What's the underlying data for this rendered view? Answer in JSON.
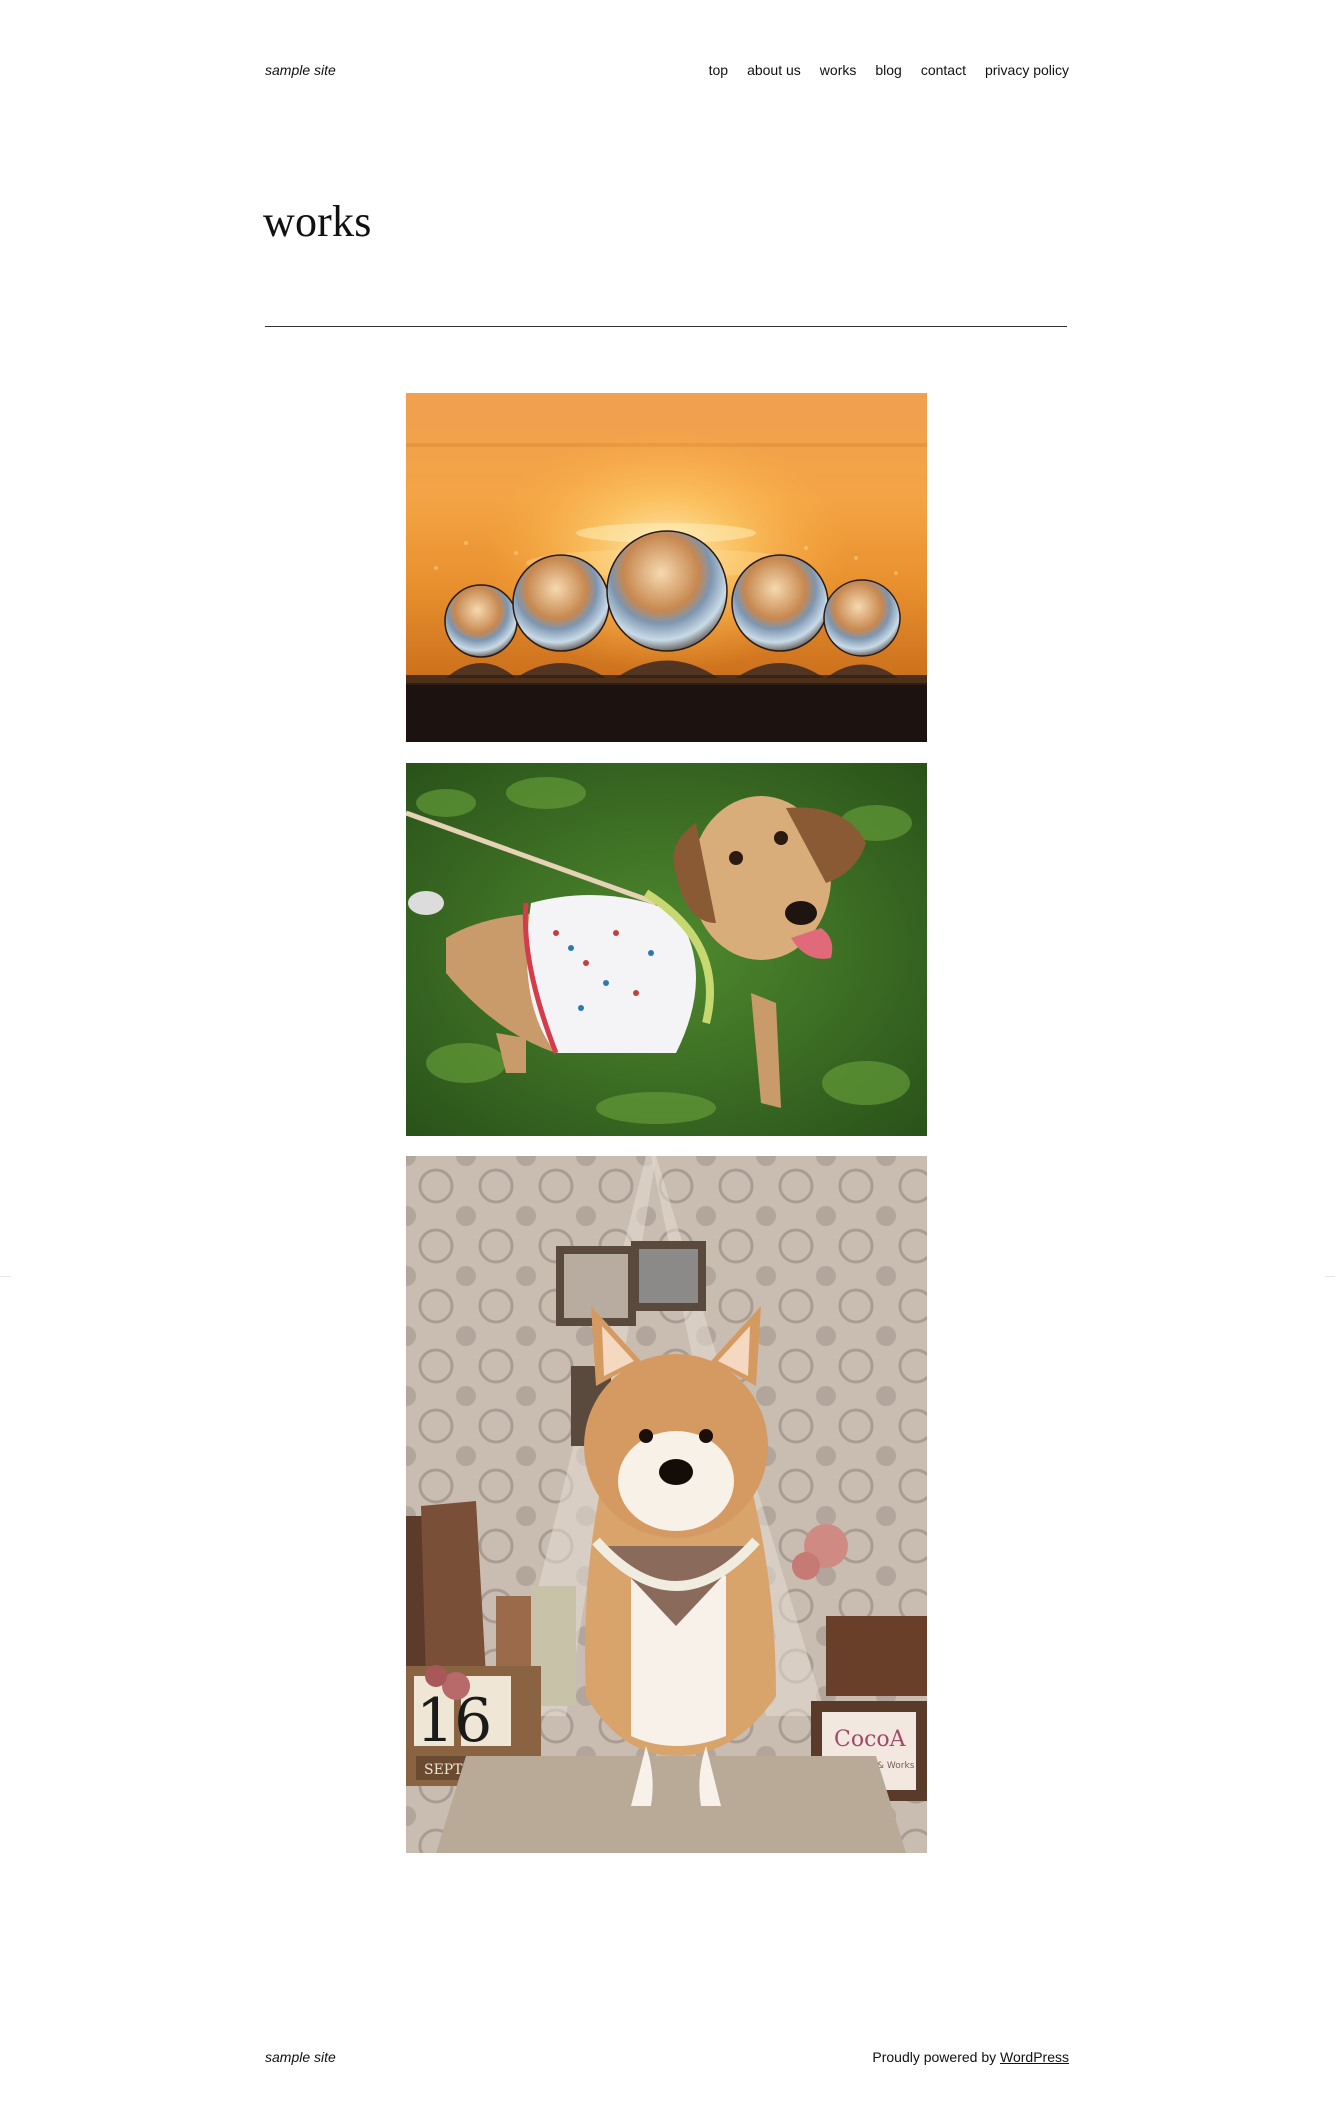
{
  "header": {
    "site_title": "sample site",
    "nav": [
      {
        "label": "top"
      },
      {
        "label": "about us"
      },
      {
        "label": "works"
      },
      {
        "label": "blog"
      },
      {
        "label": "contact"
      },
      {
        "label": "privacy policy"
      }
    ]
  },
  "main": {
    "page_title": "works",
    "gallery": [
      {
        "subject": "crystal balls at sunset by the sea",
        "calendar_day": "",
        "calendar_month": "",
        "sign_text": "",
        "sign_subtext": ""
      },
      {
        "subject": "dog in a patterned shirt on grass",
        "calendar_day": "",
        "calendar_month": "",
        "sign_text": "",
        "sign_subtext": ""
      },
      {
        "subject": "shiba inu with bandana in a studio set",
        "calendar_day": "16",
        "calendar_month": "SEPTEMBER",
        "sign_text": "CocoA",
        "sign_subtext": "Grooming & Works"
      }
    ]
  },
  "footer": {
    "site_title": "sample site",
    "credit_prefix": "Proudly powered by ",
    "credit_link": "WordPress"
  },
  "colors": {
    "text": "#111111",
    "background": "#ffffff",
    "divider": "#333333"
  }
}
